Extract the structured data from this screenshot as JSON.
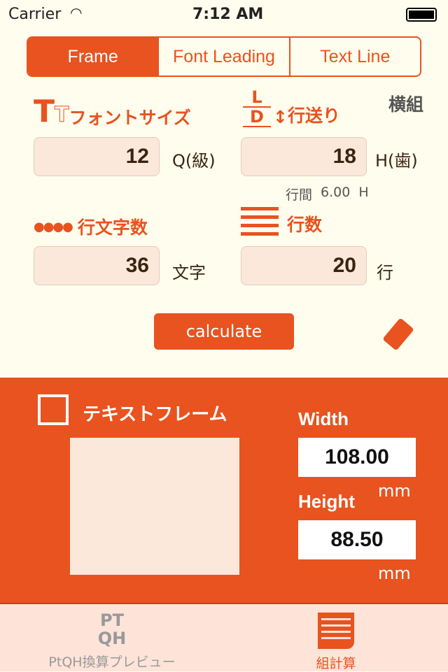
{
  "status": {
    "carrier": "Carrier",
    "time": "7:12 AM"
  },
  "segments": [
    "Frame",
    "Font Leading",
    "Text Line"
  ],
  "orientation": "横組",
  "font_size": {
    "label": "フォントサイズ",
    "value": "12",
    "unit": "Q(級)"
  },
  "leading": {
    "label": "行送り",
    "value": "18",
    "unit": "H(歯)",
    "gap_label": "行間",
    "gap_value": "6.00",
    "gap_unit": "H"
  },
  "chars": {
    "label": "行文字数",
    "value": "36",
    "unit": "文字"
  },
  "lines": {
    "label": "行数",
    "value": "20",
    "unit": "行"
  },
  "calculate_label": "calculate",
  "result": {
    "title": "テキストフレーム",
    "width_label": "Width",
    "width_value": "108.00",
    "height_label": "Height",
    "height_value": "88.50",
    "unit": "mm"
  },
  "tabs": [
    {
      "label": "PtQH換算プレビュー",
      "icon": "ptqh-icon"
    },
    {
      "label": "組計算",
      "icon": "document-icon",
      "active": true
    }
  ],
  "colors": {
    "accent": "#e8531f",
    "background": "#fffdee",
    "input": "#fbe8da"
  }
}
